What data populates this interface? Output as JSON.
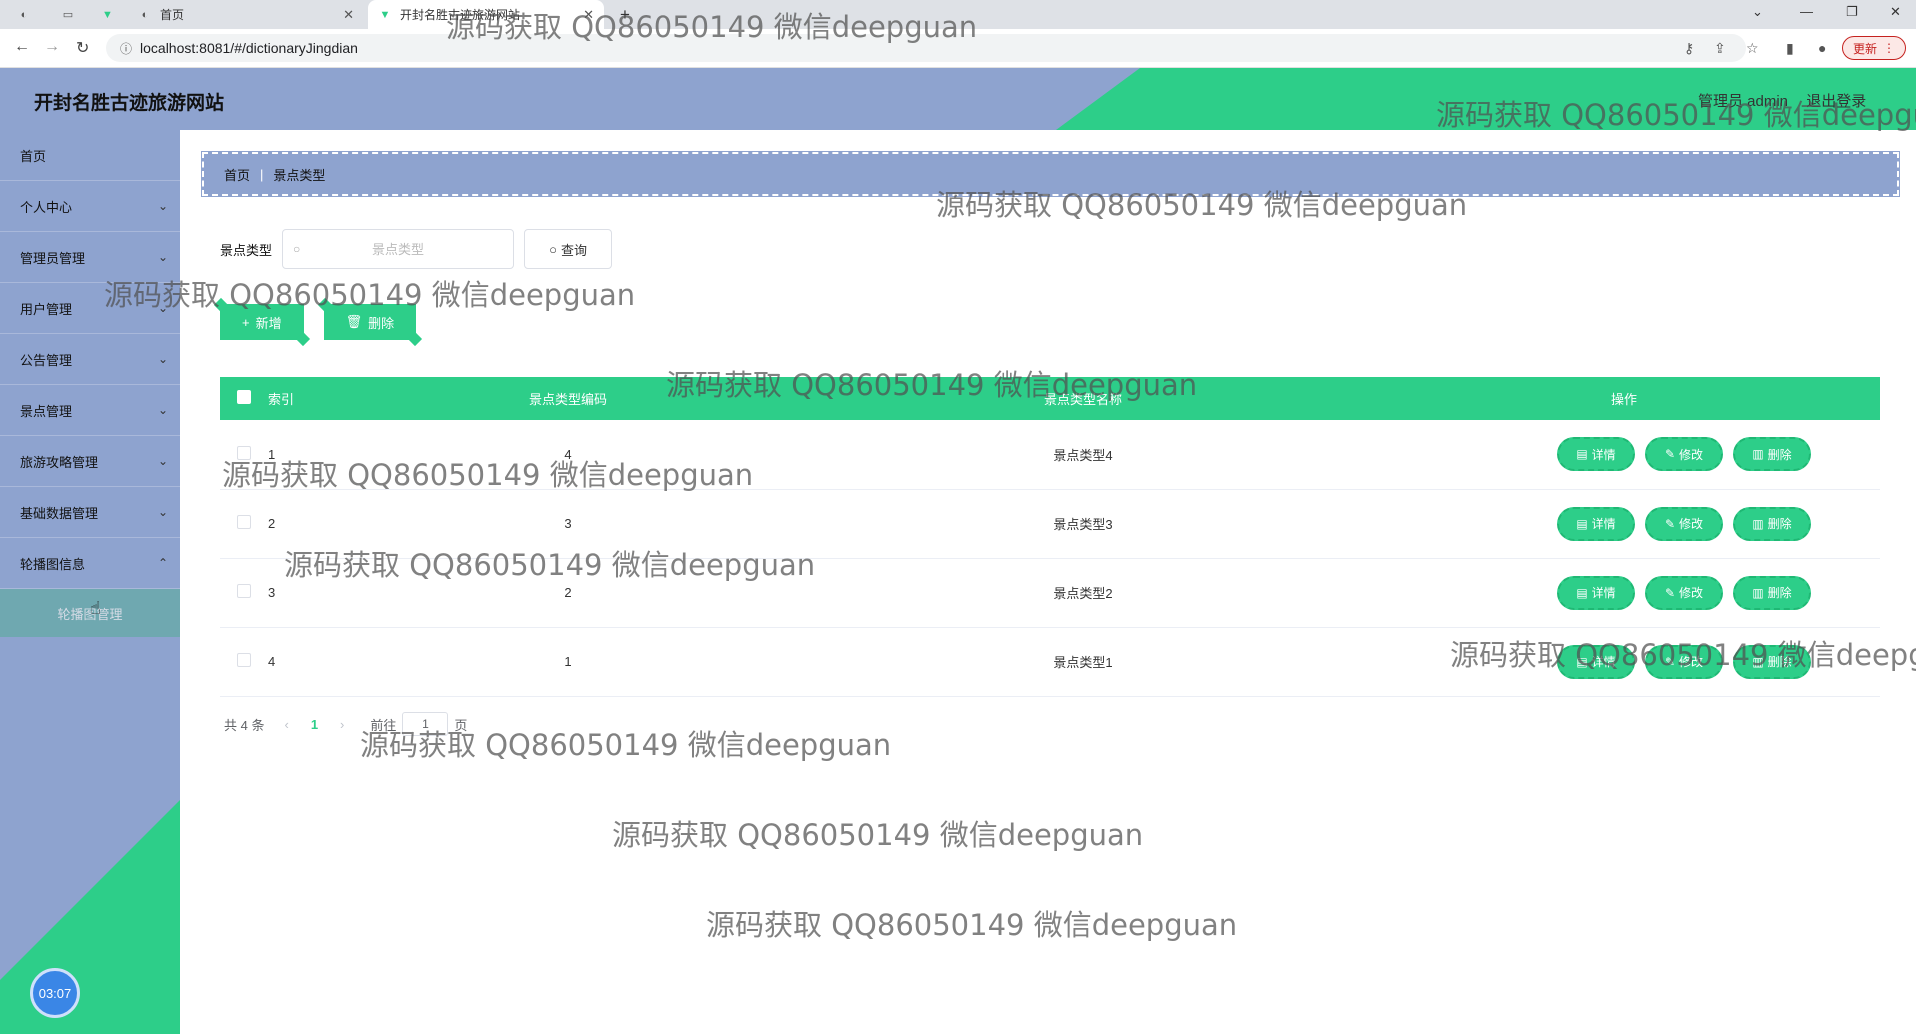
{
  "browser": {
    "tabs": [
      {
        "title": "首页"
      },
      {
        "title": "开封名胜古迹旅游网站"
      }
    ],
    "url": "localhost:8081/#/dictionaryJingdian",
    "update_label": "更新"
  },
  "header": {
    "title": "开封名胜古迹旅游网站",
    "user_role": "管理员 admin",
    "logout": "退出登录"
  },
  "sidebar": {
    "items": [
      {
        "label": "首页"
      },
      {
        "label": "个人中心"
      },
      {
        "label": "管理员管理"
      },
      {
        "label": "用户管理"
      },
      {
        "label": "公告管理"
      },
      {
        "label": "景点管理"
      },
      {
        "label": "旅游攻略管理"
      },
      {
        "label": "基础数据管理"
      },
      {
        "label": "轮播图信息"
      }
    ],
    "submenu_label": "轮播图管理",
    "timer": "03:07"
  },
  "breadcrumb": {
    "home": "首页",
    "current": "景点类型"
  },
  "search": {
    "label": "景点类型",
    "placeholder": "景点类型",
    "query_button": "查询"
  },
  "actions": {
    "add": "新增",
    "delete": "删除"
  },
  "table": {
    "headers": [
      "索引",
      "景点类型编码",
      "景点类型名称",
      "操作"
    ],
    "rows": [
      {
        "index": "1",
        "code": "4",
        "name": "景点类型4"
      },
      {
        "index": "2",
        "code": "3",
        "name": "景点类型3"
      },
      {
        "index": "3",
        "code": "2",
        "name": "景点类型2"
      },
      {
        "index": "4",
        "code": "1",
        "name": "景点类型1"
      }
    ],
    "op_labels": {
      "detail": "详情",
      "edit": "修改",
      "delete": "删除"
    }
  },
  "pagination": {
    "total": "共 4 条",
    "current_page": "1",
    "goto_prefix": "前往",
    "goto_value": "1",
    "goto_suffix": "页"
  },
  "watermark": "源码获取 QQ86050149 微信deepguan"
}
